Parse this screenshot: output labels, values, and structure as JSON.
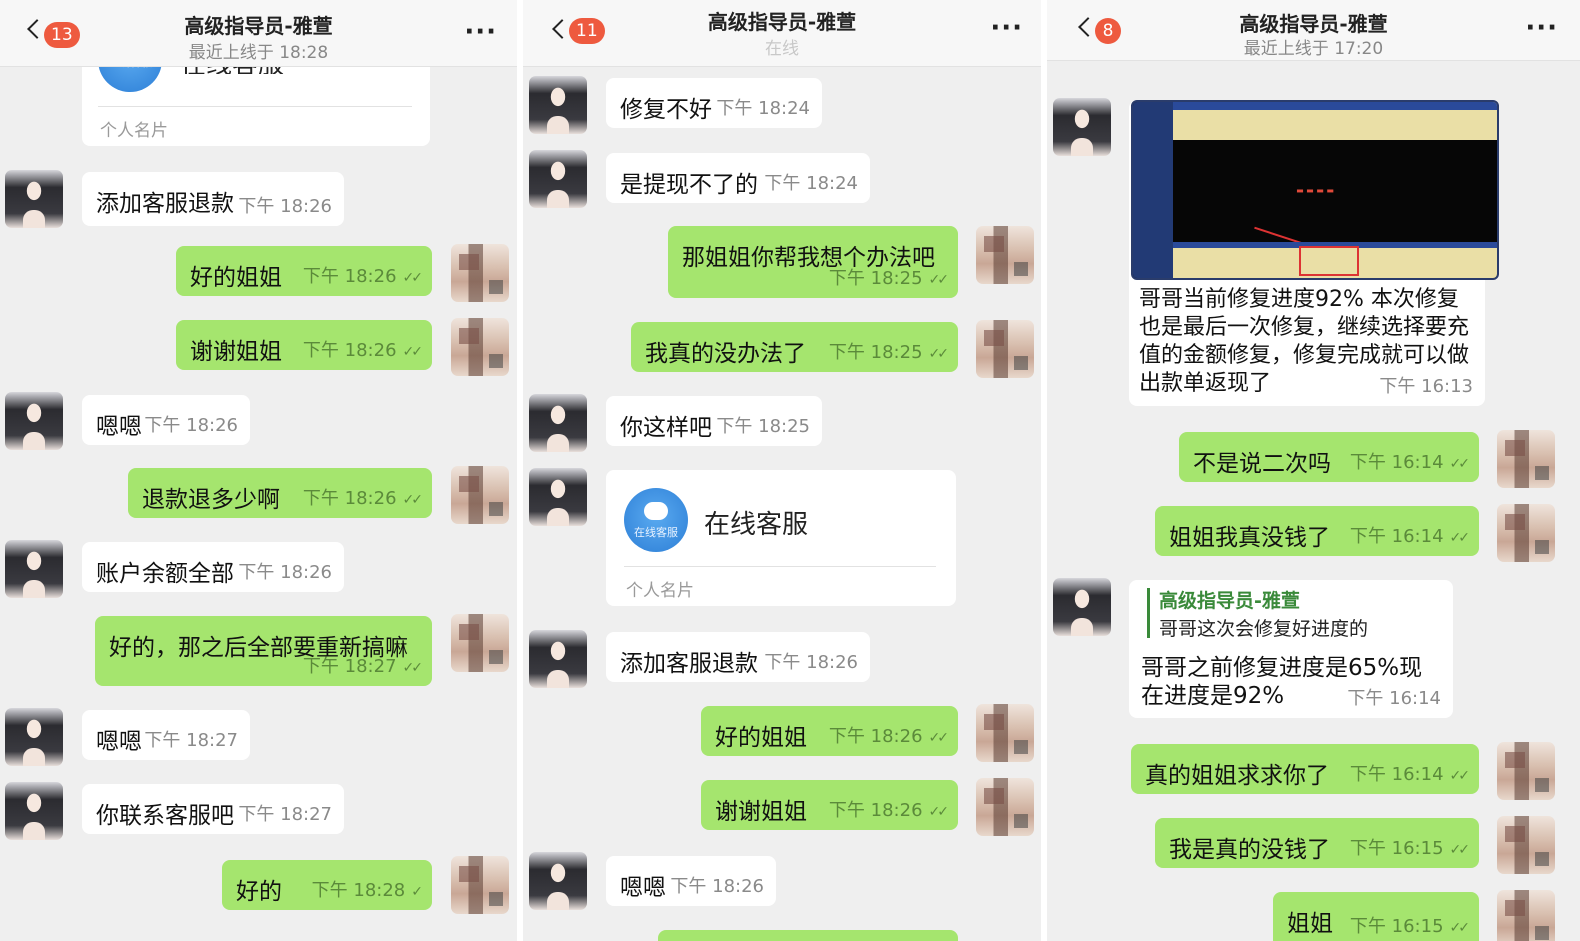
{
  "panel1": {
    "header": {
      "badge": "13",
      "title": "高级指导员-雅萱",
      "subtitle": "最近上线于 18:28"
    },
    "card": {
      "icon_caption": "在线客服",
      "name_partial": "在线客服",
      "type": "个人名片"
    },
    "messages": [
      {
        "text": "添加客服退款",
        "time": "下午 18:26"
      },
      {
        "text": "好的姐姐",
        "time": "下午 18:26"
      },
      {
        "text": "谢谢姐姐",
        "time": "下午 18:26"
      },
      {
        "text": "嗯嗯",
        "time": "下午 18:26"
      },
      {
        "text": "退款退多少啊",
        "time": "下午 18:26"
      },
      {
        "text": "账户余额全部",
        "time": "下午 18:26"
      },
      {
        "text": "好的，那之后全部要重新搞嘛",
        "time": "下午 18:27"
      },
      {
        "text": "嗯嗯",
        "time": "下午 18:27"
      },
      {
        "text": "你联系客服吧",
        "time": "下午 18:27"
      },
      {
        "text": "好的",
        "time": "下午 18:28"
      }
    ]
  },
  "panel2": {
    "header": {
      "badge": "11",
      "title": "高级指导员-雅萱",
      "subtitle": "在线"
    },
    "card": {
      "icon_caption": "在线客服",
      "name": "在线客服",
      "type": "个人名片"
    },
    "messages": [
      {
        "text": "修复不好",
        "time": "下午 18:24"
      },
      {
        "text": "是提现不了的",
        "time": "下午 18:24"
      },
      {
        "text": "那姐姐你帮我想个办法吧",
        "time": "下午 18:25"
      },
      {
        "text": "我真的没办法了",
        "time": "下午 18:25"
      },
      {
        "text": "你这样吧",
        "time": "下午 18:25"
      },
      {
        "text": "添加客服退款",
        "time": "下午 18:26"
      },
      {
        "text": "好的姐姐",
        "time": "下午 18:26"
      },
      {
        "text": "谢谢姐姐",
        "time": "下午 18:26"
      },
      {
        "text": "嗯嗯",
        "time": "下午 18:26"
      }
    ]
  },
  "panel3": {
    "header": {
      "badge": "8",
      "title": "高级指导员-雅萱",
      "subtitle": "最近上线于 17:20"
    },
    "image_msg": {
      "caption": "哥哥当前修复进度92% 本次修复也是最后一次修复，继续选择要充值的金额修复，修复完成就可以做出款单返现了",
      "time": "下午 16:13",
      "screen_progress_pct": 92
    },
    "reply": {
      "quote_name": "高级指导员-雅萱",
      "quote_text": "哥哥这次会修复好进度的",
      "text": "哥哥之前修复进度是65%现在进度是92%",
      "time": "下午 16:14"
    },
    "messages": [
      {
        "text": "不是说二次吗",
        "time": "下午 16:14"
      },
      {
        "text": "姐姐我真没钱了",
        "time": "下午 16:14"
      },
      {
        "text": "真的姐姐求求你了",
        "time": "下午 16:14"
      },
      {
        "text": "我是真的没钱了",
        "time": "下午 16:15"
      },
      {
        "text": "姐姐",
        "time": "下午 16:15"
      }
    ]
  }
}
